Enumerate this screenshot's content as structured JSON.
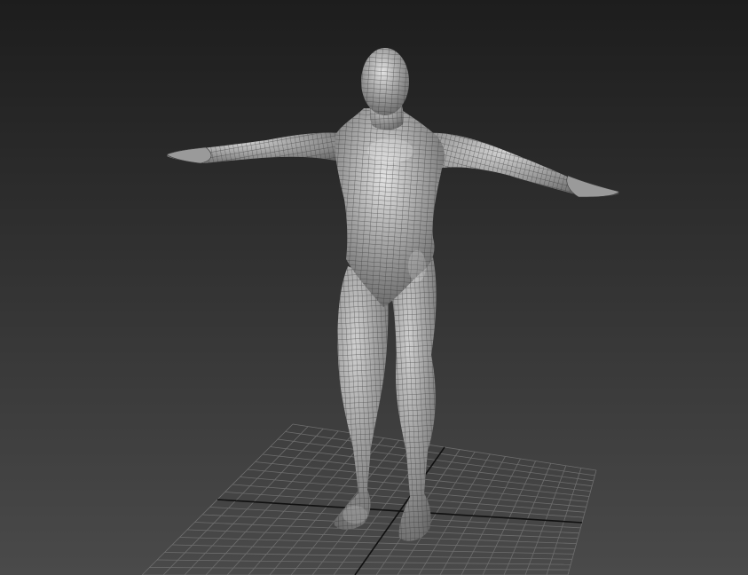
{
  "viewport": {
    "background_top": "#1d1d1d",
    "background_bottom": "#4a4a4a",
    "grid_color": "#6e6e6e",
    "grid_axis_color": "#101010",
    "mesh_fill": "#8a8a8a",
    "mesh_highlight": "#d8d8d8",
    "wire_color": "#2e2e2e",
    "model": "human-male-t-pose-mesh",
    "shading": "edged-faces"
  }
}
